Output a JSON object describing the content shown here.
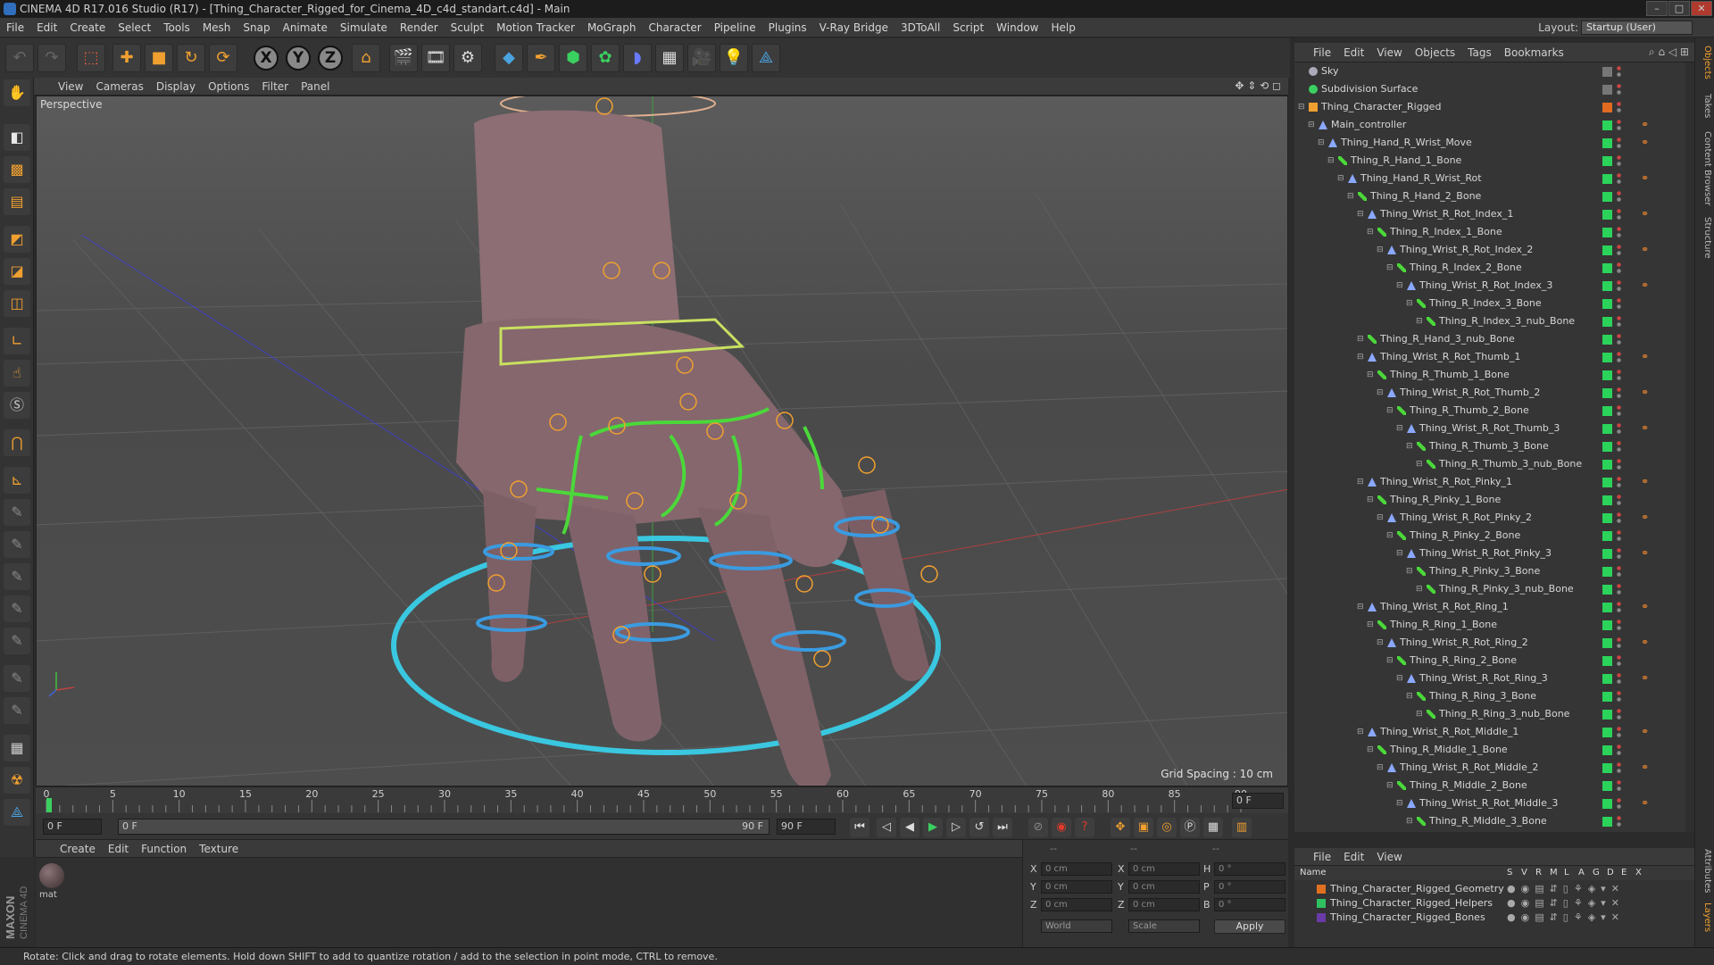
{
  "window": {
    "title": "CINEMA 4D R17.016 Studio (R17) - [Thing_Character_Rigged_for_Cinema_4D_c4d_standart.c4d] - Main"
  },
  "menubar": {
    "items": [
      "File",
      "Edit",
      "Create",
      "Select",
      "Tools",
      "Mesh",
      "Snap",
      "Animate",
      "Simulate",
      "Render",
      "Sculpt",
      "Motion Tracker",
      "MoGraph",
      "Character",
      "Pipeline",
      "Plugins",
      "V-Ray Bridge",
      "3DToAll",
      "Script",
      "Window",
      "Help"
    ],
    "layout_label": "Layout:",
    "layout_value": "Startup (User)"
  },
  "toolbar": {
    "axis_x": "X",
    "axis_y": "Y",
    "axis_z": "Z"
  },
  "viewport": {
    "menu": [
      "View",
      "Cameras",
      "Display",
      "Options",
      "Filter",
      "Panel"
    ],
    "label": "Perspective",
    "grid_spacing": "Grid Spacing : 10 cm"
  },
  "timeline": {
    "ticks": [
      "0",
      "5",
      "10",
      "15",
      "20",
      "25",
      "30",
      "35",
      "40",
      "45",
      "50",
      "55",
      "60",
      "65",
      "70",
      "75",
      "80",
      "85",
      "90"
    ],
    "current_frame": "0 F",
    "start_frame": "0 F",
    "range_start": "0 F",
    "range_end": "90 F",
    "end_frame": "90 F"
  },
  "material_manager": {
    "menu": [
      "Create",
      "Edit",
      "Function",
      "Texture"
    ],
    "material_name": "mat"
  },
  "coordinates": {
    "header": [
      "--",
      "--",
      "--"
    ],
    "rows": [
      {
        "axis": "X",
        "pos": "0 cm",
        "axis2": "X",
        "size": "0 cm",
        "rot_label": "H",
        "rot": "0 °"
      },
      {
        "axis": "Y",
        "pos": "0 cm",
        "axis2": "Y",
        "size": "0 cm",
        "rot_label": "P",
        "rot": "0 °"
      },
      {
        "axis": "Z",
        "pos": "0 cm",
        "axis2": "Z",
        "size": "0 cm",
        "rot_label": "B",
        "rot": "0 °"
      }
    ],
    "mode1": "World",
    "mode2": "Scale",
    "apply": "Apply"
  },
  "status": {
    "text": "Rotate: Click and drag to rotate elements. Hold down SHIFT to add to quantize rotation / add to the selection in point mode, CTRL to remove."
  },
  "object_manager": {
    "menu": [
      "File",
      "Edit",
      "View",
      "Objects",
      "Tags",
      "Bookmarks"
    ],
    "rows": [
      {
        "name": "Sky",
        "level": 0,
        "type": "sky"
      },
      {
        "name": "Subdivision Surface",
        "level": 0,
        "type": "subd"
      },
      {
        "name": "Thing_Character_Rigged",
        "level": 0,
        "type": "null"
      },
      {
        "name": "Main_controller",
        "level": 1,
        "type": "joint"
      },
      {
        "name": "Thing_Hand_R_Wrist_Move",
        "level": 2,
        "type": "joint"
      },
      {
        "name": "Thing_R_Hand_1_Bone",
        "level": 3,
        "type": "bone"
      },
      {
        "name": "Thing_Hand_R_Wrist_Rot",
        "level": 4,
        "type": "joint"
      },
      {
        "name": "Thing_R_Hand_2_Bone",
        "level": 5,
        "type": "bone"
      },
      {
        "name": "Thing_Wrist_R_Rot_Index_1",
        "level": 6,
        "type": "joint"
      },
      {
        "name": "Thing_R_Index_1_Bone",
        "level": 7,
        "type": "bone"
      },
      {
        "name": "Thing_Wrist_R_Rot_Index_2",
        "level": 8,
        "type": "joint"
      },
      {
        "name": "Thing_R_Index_2_Bone",
        "level": 9,
        "type": "bone"
      },
      {
        "name": "Thing_Wrist_R_Rot_Index_3",
        "level": 10,
        "type": "joint"
      },
      {
        "name": "Thing_R_Index_3_Bone",
        "level": 11,
        "type": "bone"
      },
      {
        "name": "Thing_R_Index_3_nub_Bone",
        "level": 12,
        "type": "bone"
      },
      {
        "name": "Thing_R_Hand_3_nub_Bone",
        "level": 6,
        "type": "bone"
      },
      {
        "name": "Thing_Wrist_R_Rot_Thumb_1",
        "level": 6,
        "type": "joint"
      },
      {
        "name": "Thing_R_Thumb_1_Bone",
        "level": 7,
        "type": "bone"
      },
      {
        "name": "Thing_Wrist_R_Rot_Thumb_2",
        "level": 8,
        "type": "joint"
      },
      {
        "name": "Thing_R_Thumb_2_Bone",
        "level": 9,
        "type": "bone"
      },
      {
        "name": "Thing_Wrist_R_Rot_Thumb_3",
        "level": 10,
        "type": "joint"
      },
      {
        "name": "Thing_R_Thumb_3_Bone",
        "level": 11,
        "type": "bone"
      },
      {
        "name": "Thing_R_Thumb_3_nub_Bone",
        "level": 12,
        "type": "bone"
      },
      {
        "name": "Thing_Wrist_R_Rot_Pinky_1",
        "level": 6,
        "type": "joint"
      },
      {
        "name": "Thing_R_Pinky_1_Bone",
        "level": 7,
        "type": "bone"
      },
      {
        "name": "Thing_Wrist_R_Rot_Pinky_2",
        "level": 8,
        "type": "joint"
      },
      {
        "name": "Thing_R_Pinky_2_Bone",
        "level": 9,
        "type": "bone"
      },
      {
        "name": "Thing_Wrist_R_Rot_Pinky_3",
        "level": 10,
        "type": "joint"
      },
      {
        "name": "Thing_R_Pinky_3_Bone",
        "level": 11,
        "type": "bone"
      },
      {
        "name": "Thing_R_Pinky_3_nub_Bone",
        "level": 12,
        "type": "bone"
      },
      {
        "name": "Thing_Wrist_R_Rot_Ring_1",
        "level": 6,
        "type": "joint"
      },
      {
        "name": "Thing_R_Ring_1_Bone",
        "level": 7,
        "type": "bone"
      },
      {
        "name": "Thing_Wrist_R_Rot_Ring_2",
        "level": 8,
        "type": "joint"
      },
      {
        "name": "Thing_R_Ring_2_Bone",
        "level": 9,
        "type": "bone"
      },
      {
        "name": "Thing_Wrist_R_Rot_Ring_3",
        "level": 10,
        "type": "joint"
      },
      {
        "name": "Thing_R_Ring_3_Bone",
        "level": 11,
        "type": "bone"
      },
      {
        "name": "Thing_R_Ring_3_nub_Bone",
        "level": 12,
        "type": "bone"
      },
      {
        "name": "Thing_Wrist_R_Rot_Middle_1",
        "level": 6,
        "type": "joint"
      },
      {
        "name": "Thing_R_Middle_1_Bone",
        "level": 7,
        "type": "bone"
      },
      {
        "name": "Thing_Wrist_R_Rot_Middle_2",
        "level": 8,
        "type": "joint"
      },
      {
        "name": "Thing_R_Middle_2_Bone",
        "level": 9,
        "type": "bone"
      },
      {
        "name": "Thing_Wrist_R_Rot_Middle_3",
        "level": 10,
        "type": "joint"
      },
      {
        "name": "Thing_R_Middle_3_Bone",
        "level": 11,
        "type": "bone"
      }
    ]
  },
  "layer_manager": {
    "menu": [
      "File",
      "Edit",
      "View"
    ],
    "columns": [
      "Name",
      "S",
      "V",
      "R",
      "M",
      "L",
      "A",
      "G",
      "D",
      "E",
      "X"
    ],
    "layers": [
      {
        "name": "Thing_Character_Rigged_Geometry",
        "color": "#e07020"
      },
      {
        "name": "Thing_Character_Rigged_Helpers",
        "color": "#30c060"
      },
      {
        "name": "Thing_Character_Rigged_Bones",
        "color": "#6a3aa8"
      }
    ]
  },
  "right_tabs": [
    "Objects",
    "Takes",
    "Content Browser",
    "Structure",
    "Attributes",
    "Layers"
  ],
  "colors": {
    "accent_orange": "#f0a030",
    "rig_green": "#4bd83a",
    "rig_blue": "#3a9be0",
    "rig_cyan": "#3ac7e0",
    "skin": "#8c6e74"
  }
}
